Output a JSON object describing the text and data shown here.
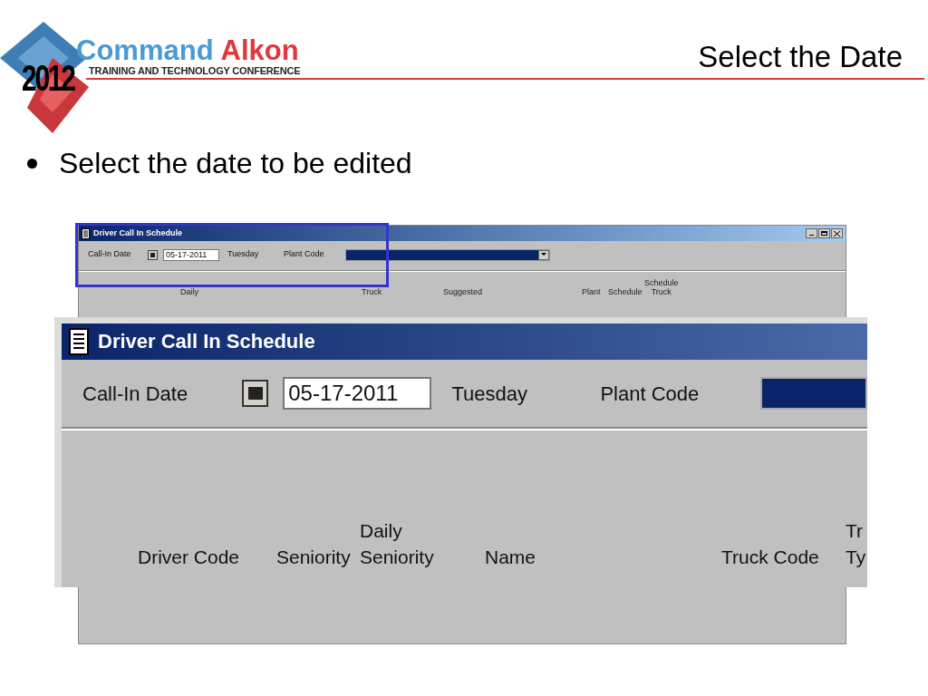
{
  "slide": {
    "logo": {
      "year": "2012",
      "brand_first": "Command",
      "brand_second": "Alkon",
      "tagline": "TRAINING AND TECHNOLOGY CONFERENCE"
    },
    "title": "Select the Date",
    "bullets": [
      "Select the date to be edited"
    ]
  },
  "window": {
    "title": "Driver Call In Schedule",
    "call_in_date_label": "Call-In Date",
    "date": "05-17-2011",
    "weekday": "Tuesday",
    "plant_code_label": "Plant Code",
    "columns": [
      {
        "lines": [
          "Daily"
        ]
      },
      {
        "lines": [
          "Truck"
        ]
      },
      {
        "lines": [
          "Suggested"
        ]
      },
      {
        "lines": [
          "Plant"
        ]
      },
      {
        "lines": [
          "Schedule"
        ]
      },
      {
        "lines": [
          "Schedule",
          "Truck"
        ]
      }
    ]
  },
  "zoom": {
    "title": "Driver Call In Schedule",
    "call_in_date_label": "Call-In Date",
    "date": "05-17-2011",
    "weekday": "Tuesday",
    "plant_code_label": "Plant Code",
    "columns": [
      {
        "lines": [
          "Driver Code"
        ]
      },
      {
        "lines": [
          "Seniority"
        ]
      },
      {
        "lines": [
          "Daily",
          "Seniority"
        ]
      },
      {
        "lines": [
          "Name"
        ]
      },
      {
        "lines": [
          "Truck Code"
        ]
      },
      {
        "lines": [
          "Tr",
          "Ty"
        ]
      }
    ]
  }
}
